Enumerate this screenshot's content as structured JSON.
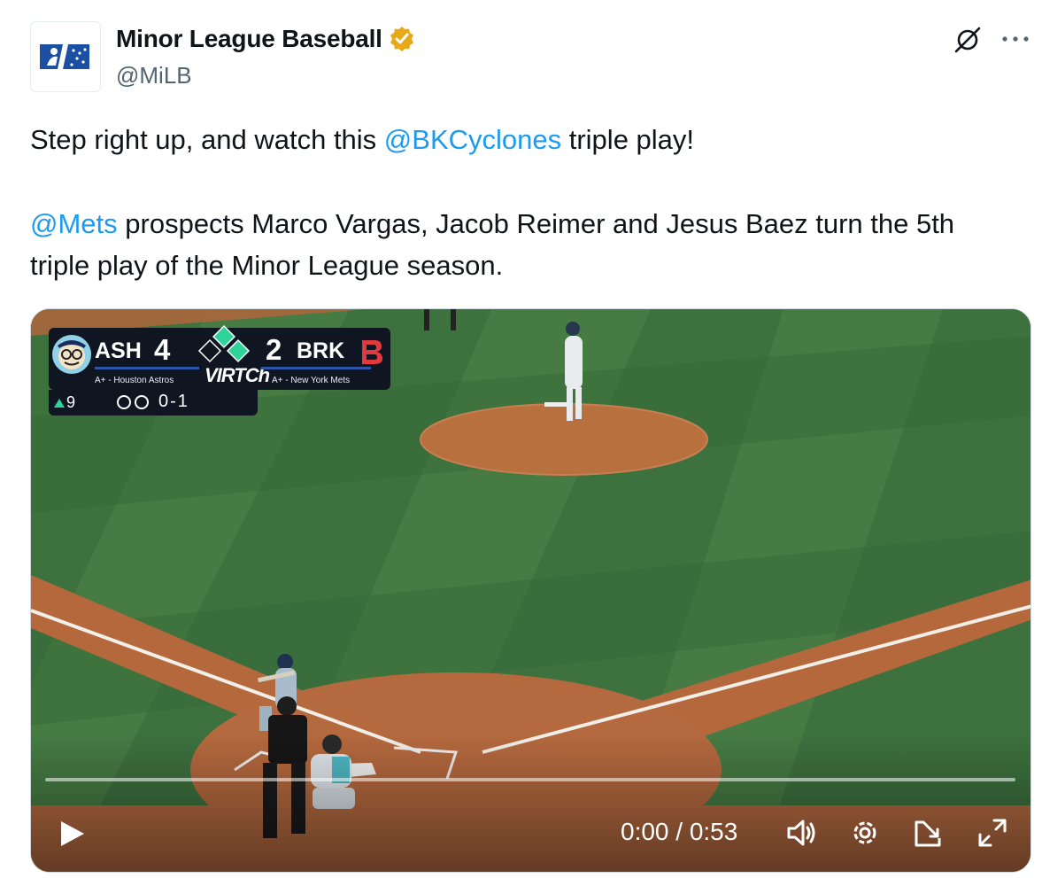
{
  "author": {
    "display_name": "Minor League Baseball",
    "handle": "@MiLB",
    "verified_color": "#e8a917"
  },
  "header_icons": [
    "grok-icon",
    "more-icon"
  ],
  "tweet": {
    "line1_before": "Step right up, and watch this ",
    "line1_mention": "@BKCyclones",
    "line1_after": " triple play!",
    "line2_mention": "@Mets",
    "line2_after": " prospects Marco Vargas, Jacob Reimer and Jesus Baez turn the 5th triple play of the Minor League season."
  },
  "scorebug": {
    "away_abbr": "ASH",
    "away_score": "4",
    "away_affiliate": "A+ - Houston Astros",
    "home_score": "2",
    "home_abbr": "BRK",
    "home_affiliate": "A+ - New York Mets",
    "sponsor": "VIRTCh",
    "inning": "9",
    "inning_half": "top",
    "count": "0-1",
    "outs": 0
  },
  "video": {
    "time_display": "0:00 / 0:53",
    "progress": 0.0,
    "controls": [
      "play-icon",
      "volume-icon",
      "settings-icon",
      "pip-icon",
      "fullscreen-icon"
    ]
  },
  "colors": {
    "link": "#1d9bf0",
    "secondary_text": "#536471",
    "grass": "#3b6d3b",
    "dirt": "#b0663c",
    "accent_green": "#2fd39a"
  }
}
